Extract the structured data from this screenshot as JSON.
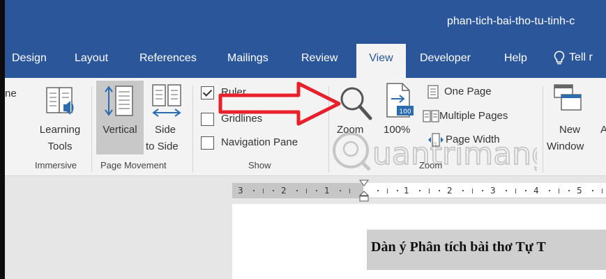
{
  "window": {
    "title": "phan-tich-bai-tho-tu-tinh-c"
  },
  "tabs": [
    {
      "label": "Design"
    },
    {
      "label": "Layout"
    },
    {
      "label": "References"
    },
    {
      "label": "Mailings"
    },
    {
      "label": "Review"
    },
    {
      "label": "View",
      "active": true
    },
    {
      "label": "Developer"
    },
    {
      "label": "Help"
    }
  ],
  "tell_me": {
    "label": "Tell r",
    "icon": "lightbulb-icon"
  },
  "ribbon": {
    "groups": {
      "immersive": {
        "partial_label": "ne",
        "learning_tools": {
          "line1": "Learning",
          "line2": "Tools",
          "icon": "learning-tools-icon"
        },
        "label": "Immersive"
      },
      "page_movement": {
        "vertical": {
          "label": "Vertical",
          "icon": "vertical-scroll-icon",
          "selected": true
        },
        "side": {
          "line1": "Side",
          "line2": "to Side",
          "icon": "side-to-side-icon"
        },
        "label": "Page Movement"
      },
      "show": {
        "ruler": {
          "label": "Ruler",
          "checked": true
        },
        "gridlines": {
          "label": "Gridlines",
          "checked": false
        },
        "navigation_pane": {
          "label": "Navigation Pane",
          "checked": false
        },
        "label": "Show"
      },
      "zoom": {
        "zoom": {
          "label": "Zoom",
          "icon": "magnifier-icon"
        },
        "hundred": {
          "label": "100%",
          "badge": "100",
          "icon": "zoom-100-icon"
        },
        "one_page": {
          "label": "One Page",
          "icon": "one-page-icon"
        },
        "multiple_pages": {
          "label": "Multiple Pages",
          "icon": "multiple-pages-icon"
        },
        "page_width": {
          "label": "Page Width",
          "icon": "page-width-icon"
        },
        "label": "Zoom"
      },
      "window": {
        "new_window": {
          "line1": "New",
          "line2": "Window",
          "icon": "new-window-icon"
        },
        "partial": "A"
      }
    }
  },
  "ruler": {
    "numbers": [
      "3",
      "2",
      "1",
      "1",
      "2",
      "3",
      "4",
      "5"
    ]
  },
  "document": {
    "heading": "Dàn ý Phân tích bài thơ Tự T"
  },
  "watermark": {
    "text": "uantrimang"
  },
  "colors": {
    "accent": "#2b579a",
    "ribbon": "#f3f3f3",
    "annotation": "#e8202a"
  }
}
